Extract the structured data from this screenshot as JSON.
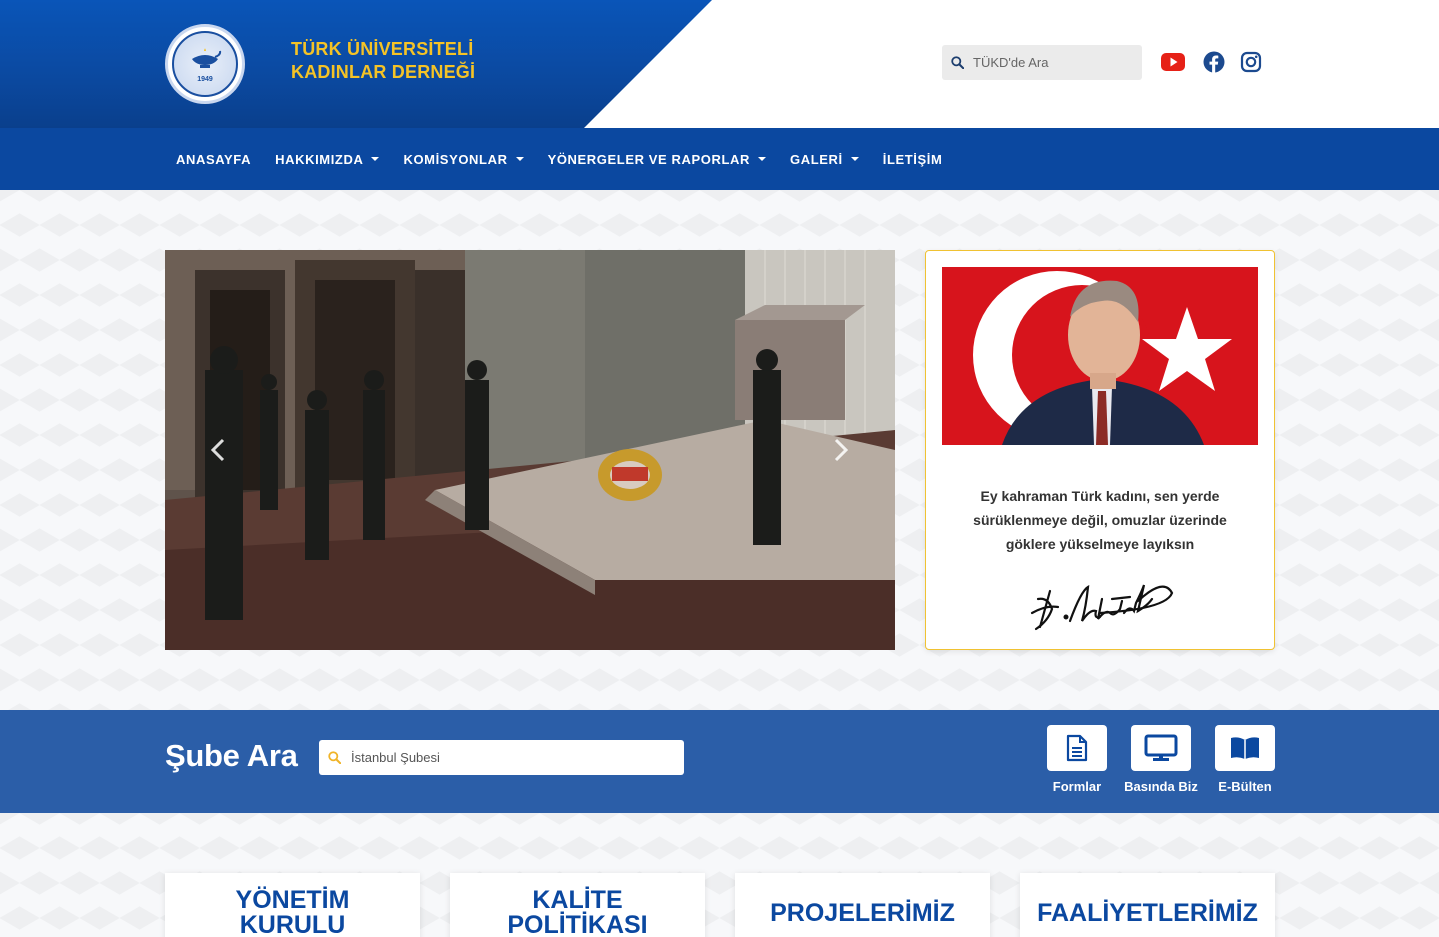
{
  "header": {
    "brand_line1": "TÜRK ÜNİVERSİTELİ",
    "brand_line2": "KADINLAR DERNEĞİ",
    "logo_year": "1949",
    "search_placeholder": "TÜKD'de Ara",
    "social": [
      "youtube-icon",
      "facebook-icon",
      "instagram-icon"
    ]
  },
  "nav": {
    "items": [
      {
        "label": "ANASAYFA",
        "dropdown": false
      },
      {
        "label": "HAKKIMIZDA",
        "dropdown": true
      },
      {
        "label": "KOMİSYONLAR",
        "dropdown": true
      },
      {
        "label": "YÖNERGELER VE RAPORLAR",
        "dropdown": true
      },
      {
        "label": "GALERİ",
        "dropdown": true
      },
      {
        "label": "İLETİŞİM",
        "dropdown": false
      }
    ]
  },
  "quote": {
    "line1": "Ey kahraman Türk kadını, sen yerde",
    "line2": "sürüklenmeye değil, omuzlar üzerinde",
    "line3": "göklere yükselmeye layıksın",
    "signature": "K. Atatürk"
  },
  "branch": {
    "title": "Şube Ara",
    "placeholder": "İstanbul Şubesi"
  },
  "quick_links": [
    {
      "label": "Formlar",
      "icon": "document-icon"
    },
    {
      "label": "Basında Biz",
      "icon": "monitor-icon"
    },
    {
      "label": "E-Bülten",
      "icon": "book-icon"
    }
  ],
  "cards": [
    {
      "title": "YÖNETİM KURULU"
    },
    {
      "title": "KALİTE POLİTİKASI"
    },
    {
      "title": "PROJELERİMİZ"
    },
    {
      "title": "FAALİYETLERİMİZ"
    }
  ],
  "colors": {
    "primary_blue": "#0b48a0",
    "brand_yellow": "#f5c326",
    "branch_bar": "#2b5ea8"
  }
}
